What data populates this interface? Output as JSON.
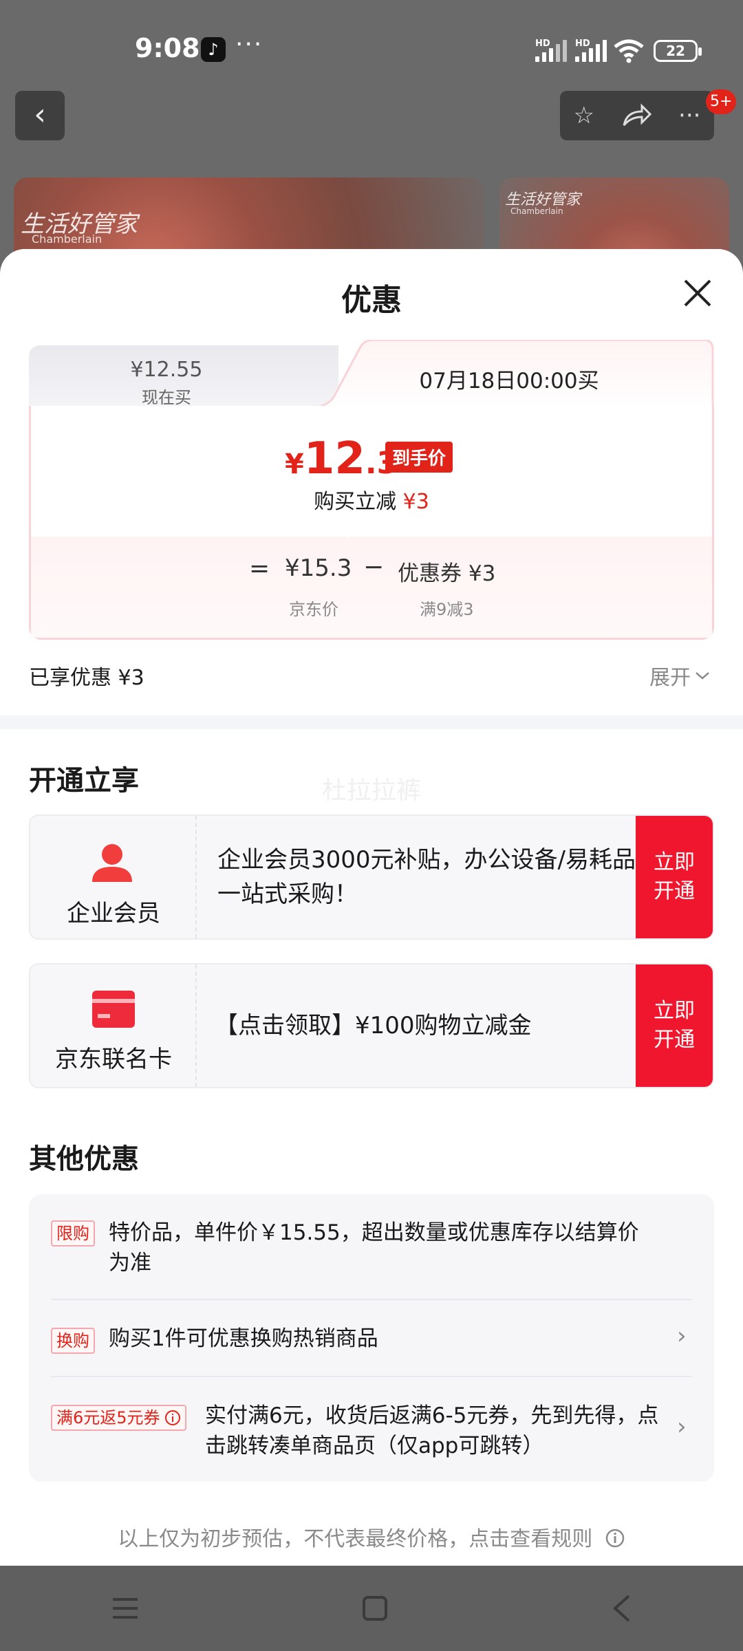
{
  "status_bar": {
    "time": "9:08",
    "more": "···",
    "hd1": "HD",
    "hd2": "HD",
    "battery": "22"
  },
  "background": {
    "badge": "5+",
    "logo_text": "生活好管家",
    "logo_sub": "Chamberlain"
  },
  "sheet": {
    "title": "优惠"
  },
  "price_tabs": {
    "now_price": "¥12.55",
    "now_label": "现在买",
    "future_label": "07月18日00:00买"
  },
  "price_card": {
    "currency": "¥",
    "price_int": "12",
    "price_dec": ".3",
    "final_tag": "到手价",
    "reduce_text": "购买立减",
    "reduce_amount": "¥3",
    "eq": "=",
    "jd_price": "¥15.3",
    "jd_price_label": "京东价",
    "minus": "−",
    "coupon": "优惠券 ¥3",
    "coupon_label": "满9减3"
  },
  "enjoyed": {
    "text": "已享优惠 ¥3",
    "expand": "展开"
  },
  "open_section": {
    "title": "开通立享",
    "watermark": "杜拉拉裤",
    "items": [
      {
        "name": "企业会员",
        "desc": "企业会员3000元补贴，办公设备/易耗品一站式采购！",
        "action": "立即开通",
        "icon": "person-icon"
      },
      {
        "name": "京东联名卡",
        "desc": "【点击领取】¥100购物立减金",
        "action": "立即开通",
        "icon": "credit-card-icon"
      }
    ]
  },
  "other_section": {
    "title": "其他优惠",
    "items": [
      {
        "tag": "限购",
        "text": "特价品，单件价￥15.55，超出数量或优惠库存以结算价为准"
      },
      {
        "tag": "换购",
        "text": "购买1件可优惠换购热销商品"
      },
      {
        "tag": "满6元返5元券",
        "text": "实付满6元，收货后返满6-5元券，先到先得，点击跳转凑单商品页（仅app可跳转）"
      }
    ]
  },
  "footnote": "以上仅为初步预估，不代表最终价格，点击查看规则",
  "colors": {
    "accent": "#e2231a",
    "button_red": "#f0162e"
  }
}
